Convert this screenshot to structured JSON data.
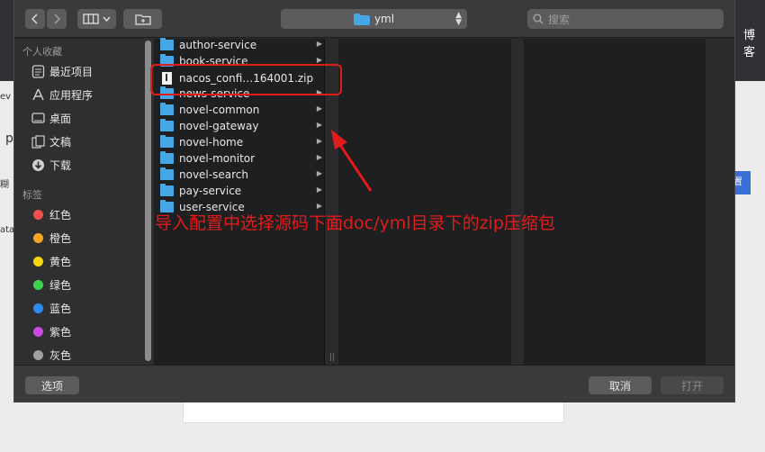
{
  "background": {
    "header_text": "博客",
    "slivers": [
      "ev",
      "p",
      "糊",
      "ata"
    ],
    "blue_button_text": "置"
  },
  "toolbar": {
    "back_icon": "chevron-left-icon",
    "forward_icon": "chevron-right-icon",
    "view_icon": "column-view-icon",
    "new_folder_icon": "new-folder-icon",
    "path_label": "yml",
    "search_placeholder": "搜索"
  },
  "sidebar": {
    "favorites_heading": "个人收藏",
    "favorites": [
      {
        "label": "最近项目",
        "icon": "clock-icon"
      },
      {
        "label": "应用程序",
        "icon": "applications-icon"
      },
      {
        "label": "桌面",
        "icon": "desktop-icon"
      },
      {
        "label": "文稿",
        "icon": "documents-icon"
      },
      {
        "label": "下载",
        "icon": "download-icon"
      }
    ],
    "tags_heading": "标签",
    "tags": [
      {
        "label": "红色",
        "color": "#f0504b"
      },
      {
        "label": "橙色",
        "color": "#f5a623"
      },
      {
        "label": "黄色",
        "color": "#f5d90a"
      },
      {
        "label": "绿色",
        "color": "#3dd34e"
      },
      {
        "label": "蓝色",
        "color": "#2e8cf0"
      },
      {
        "label": "紫色",
        "color": "#c64be0"
      },
      {
        "label": "灰色",
        "color": "#a0a0a0"
      }
    ]
  },
  "files": [
    {
      "name": "author-service",
      "type": "folder"
    },
    {
      "name": "book-service",
      "type": "folder"
    },
    {
      "name": "nacos_confi…164001.zip",
      "type": "zip"
    },
    {
      "name": "news-service",
      "type": "folder"
    },
    {
      "name": "novel-common",
      "type": "folder"
    },
    {
      "name": "novel-gateway",
      "type": "folder"
    },
    {
      "name": "novel-home",
      "type": "folder"
    },
    {
      "name": "novel-monitor",
      "type": "folder"
    },
    {
      "name": "novel-search",
      "type": "folder"
    },
    {
      "name": "pay-service",
      "type": "folder"
    },
    {
      "name": "user-service",
      "type": "folder"
    }
  ],
  "footer": {
    "options_label": "选项",
    "cancel_label": "取消",
    "open_label": "打开"
  },
  "annotation": {
    "text": "导入配置中选择源码下面doc/yml目录下的zip压缩包",
    "color": "#e21b1b"
  }
}
